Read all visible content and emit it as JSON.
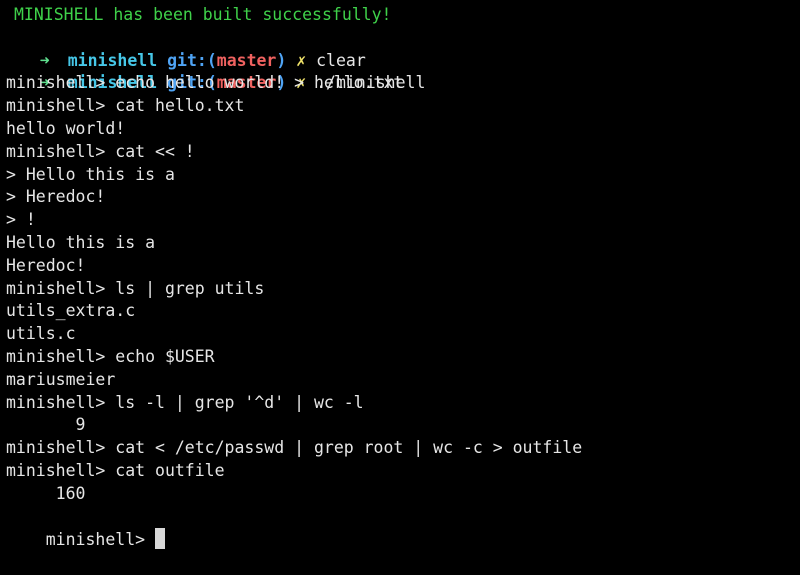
{
  "terminal": {
    "build_message": "MINISHELL has been built successfully!",
    "zsh_prompt": {
      "arrow": "➜",
      "directory": "minishell",
      "git_label": "git:(",
      "branch": "master",
      "git_close": ")",
      "dirty_mark": "✗"
    },
    "zsh_commands": [
      "clear",
      "./minishell"
    ],
    "lines": [
      "minishell> echo hello world! > hello.txt",
      "minishell> cat hello.txt",
      "hello world!",
      "minishell> cat << !",
      "> Hello this is a",
      "> Heredoc!",
      "> !",
      "Hello this is a",
      "Heredoc!",
      "minishell> ls | grep utils",
      "utils_extra.c",
      "utils.c",
      "minishell> echo $USER",
      "mariusmeier",
      "minishell> ls -l | grep '^d' | wc -l",
      "       9",
      "minishell> cat < /etc/passwd | grep root | wc -c > outfile",
      "minishell> cat outfile",
      "     160"
    ],
    "current_prompt": "minishell> "
  },
  "colors": {
    "background": "#000000",
    "text": "#e6e6e6",
    "success_green": "#3fd14a",
    "prompt_arrow": "#5fe08f",
    "directory_cyan": "#46c7e8",
    "git_blue": "#4fa4f5",
    "branch_red": "#f06260",
    "dirty_yellow": "#f0e36a",
    "cursor": "#d8d8d8"
  }
}
